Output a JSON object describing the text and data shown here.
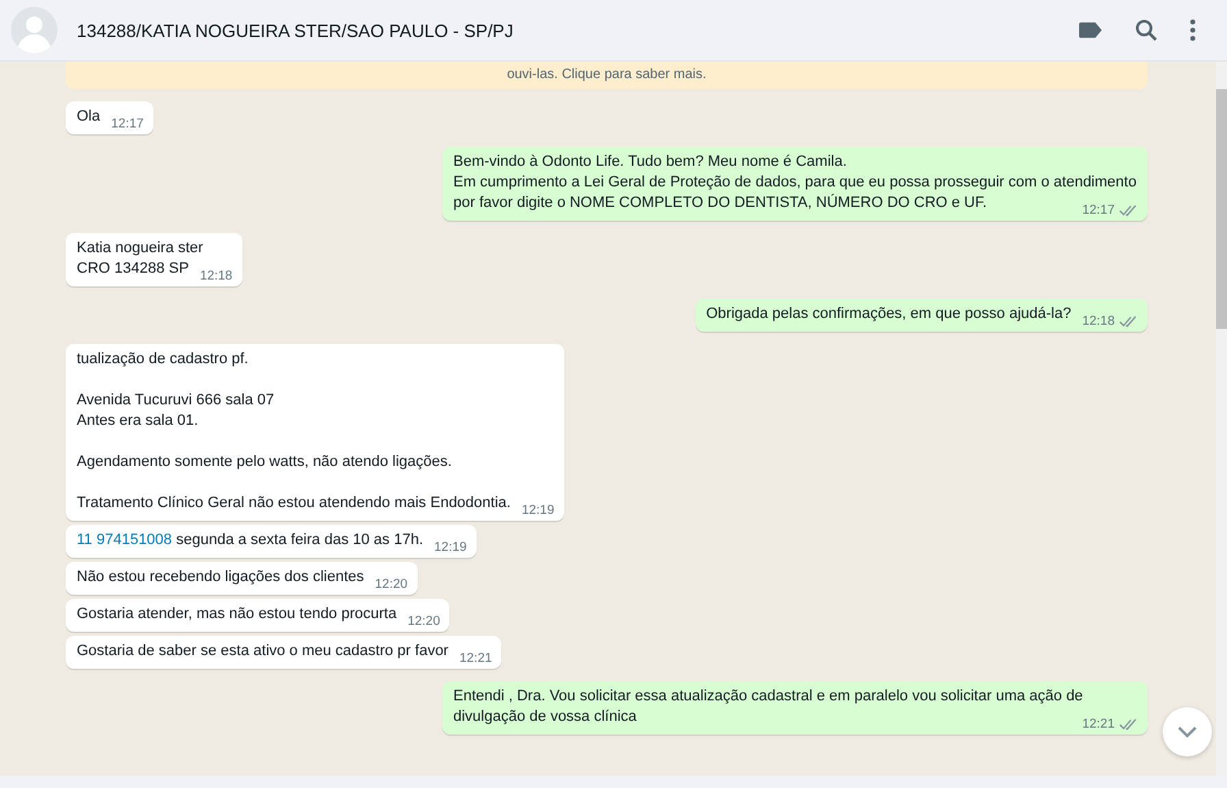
{
  "header": {
    "title": "134288/KATIA NOGUEIRA STER/SAO PAULO - SP/PJ"
  },
  "banner": {
    "text": "ouvi-las. Clique para saber mais."
  },
  "messages": [
    {
      "outgoing": false,
      "text": "Ola",
      "time": "12:17"
    },
    {
      "outgoing": true,
      "text": "Bem-vindo à Odonto Life. Tudo bem? Meu nome é Camila.\nEm cumprimento a Lei Geral de Proteção de dados, para que eu possa prosseguir com o atendimento por favor digite o NOME COMPLETO DO DENTISTA, NÚMERO DO CRO e UF.",
      "time": "12:17",
      "read": false
    },
    {
      "outgoing": false,
      "text": "Katia nogueira ster\nCRO 134288 SP",
      "time": "12:18"
    },
    {
      "outgoing": true,
      "text": "Obrigada pelas confirmações, em que posso ajudá-la?",
      "time": "12:18",
      "read": false
    },
    {
      "outgoing": false,
      "text": "tualização de cadastro pf.\n\nAvenida Tucuruvi 666 sala 07\nAntes era sala 01.\n\nAgendamento somente pelo watts, não atendo ligações.\n\nTratamento Clínico Geral não estou atendendo mais Endodontia.",
      "time": "12:19"
    },
    {
      "outgoing": false,
      "link": "11 974151008",
      "text": " segunda a sexta feira das 10 as 17h.",
      "time": "12:19"
    },
    {
      "outgoing": false,
      "text": "Não estou recebendo ligações dos clientes",
      "time": "12:20"
    },
    {
      "outgoing": false,
      "text": "Gostaria atender, mas não estou tendo procurta",
      "time": "12:20"
    },
    {
      "outgoing": false,
      "text": "Gostaria de saber se esta ativo o meu cadastro pr favor",
      "time": "12:21"
    },
    {
      "outgoing": true,
      "text": "Entendi , Dra. Vou solicitar essa atualização cadastral e em paralelo vou solicitar uma ação de divulgação de vossa clínica",
      "time": "12:21",
      "read": false
    }
  ]
}
